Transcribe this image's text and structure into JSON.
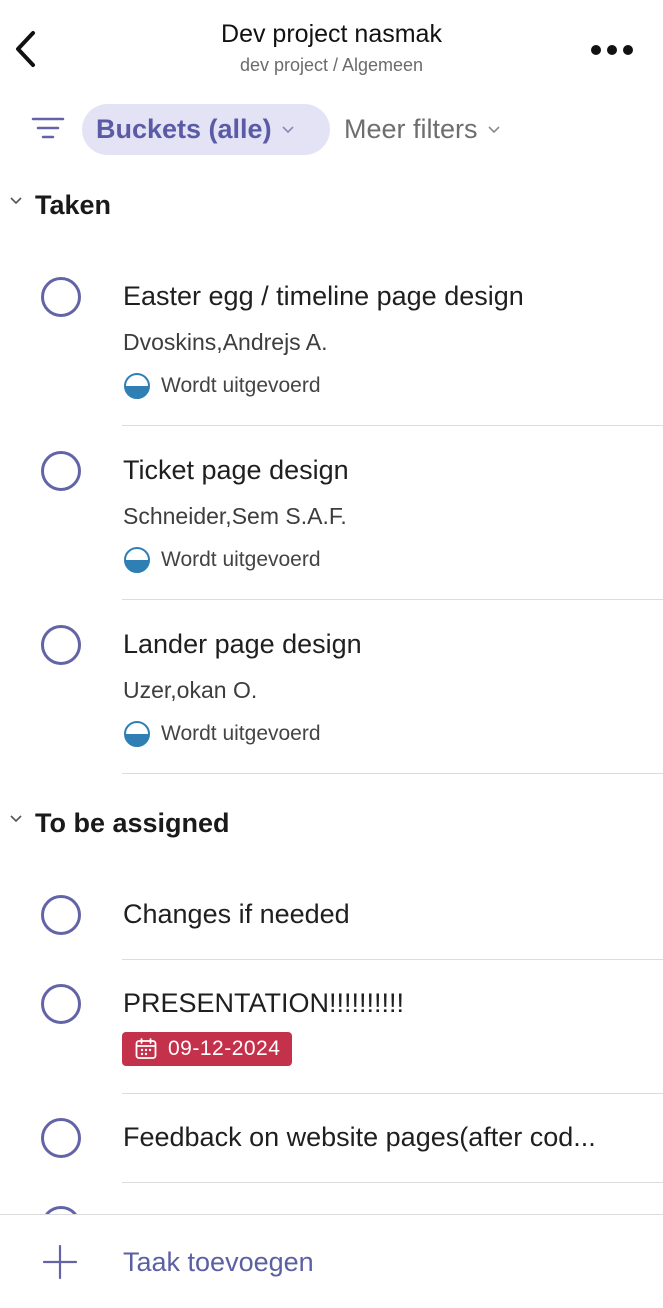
{
  "header": {
    "title": "Dev project nasmak",
    "subtitle": "dev project / Algemeen",
    "back_icon": "chevron-left-icon",
    "more_icon": "more-horizontal-icon"
  },
  "filters": {
    "filter_icon": "filter-lines-icon",
    "bucket_label": "Buckets (alle)",
    "more_filters_label": "Meer filters"
  },
  "sections": [
    {
      "title": "Taken",
      "tasks": [
        {
          "title": "Easter egg / timeline page design",
          "assignee": "Dvoskins,Andrejs A.",
          "status": "Wordt uitgevoerd"
        },
        {
          "title": "Ticket page design",
          "assignee": "Schneider,Sem S.A.F.",
          "status": "Wordt uitgevoerd"
        },
        {
          "title": "Lander page design",
          "assignee": "Uzer,okan O.",
          "status": "Wordt uitgevoerd"
        }
      ]
    },
    {
      "title": "To be assigned",
      "tasks": [
        {
          "title": "Changes if needed"
        },
        {
          "title": "PRESENTATION!!!!!!!!!!",
          "due_date": "09-12-2024"
        },
        {
          "title": "Feedback on website pages(after cod..."
        }
      ]
    }
  ],
  "footer": {
    "add_label": "Taak toevoegen",
    "add_icon": "plus-icon"
  },
  "colors": {
    "accent": "#6264a7",
    "pill_bg": "#e3e3f5",
    "status_blue": "#2f7fb5",
    "overdue_red": "#c4314b"
  }
}
